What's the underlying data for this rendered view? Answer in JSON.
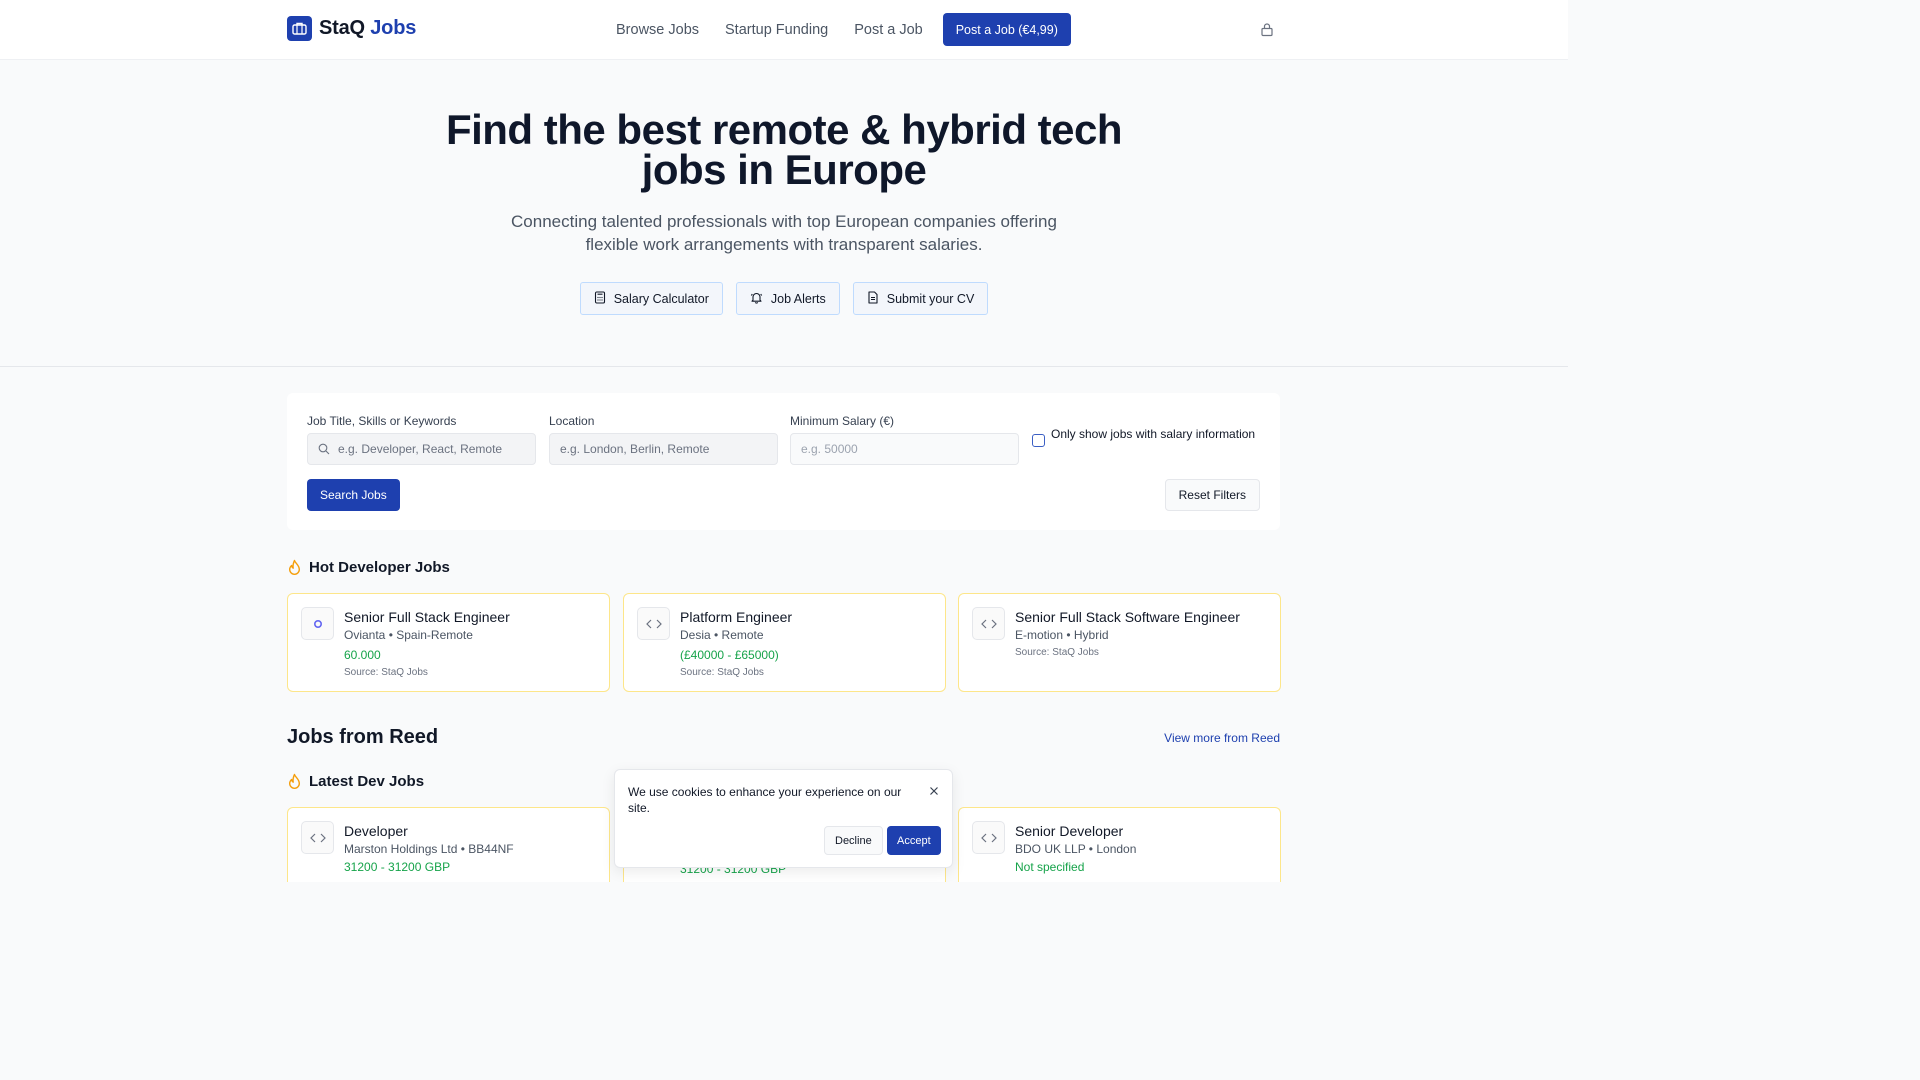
{
  "header": {
    "logo_main": "StaQ",
    "logo_accent": "Jobs",
    "nav": [
      "Browse Jobs",
      "Startup Funding",
      "Post a Job"
    ],
    "cta": "Post a Job (€4,99)"
  },
  "hero": {
    "title": "Find the best remote & hybrid tech jobs in Europe",
    "subtitle": "Connecting talented professionals with top European companies offering flexible work arrangements with transparent salaries.",
    "buttons": [
      "Salary Calculator",
      "Job Alerts",
      "Submit your CV"
    ]
  },
  "search": {
    "keyword_label": "Job Title, Skills or Keywords",
    "keyword_placeholder": "e.g. Developer, React, Remote",
    "location_label": "Location",
    "location_placeholder": "e.g. London, Berlin, Remote",
    "salary_label": "Minimum Salary (€)",
    "salary_placeholder": "e.g. 50000",
    "checkbox_label": "Only show jobs with salary information",
    "search_button": "Search Jobs",
    "reset_button": "Reset Filters"
  },
  "hot": {
    "title": "Hot Developer Jobs",
    "jobs": [
      {
        "title": "Senior Full Stack Engineer",
        "meta": "Ovianta • Spain-Remote",
        "salary": "60.000",
        "source": "Source: StaQ Jobs",
        "icon": "company-logo-icon"
      },
      {
        "title": "Platform Engineer",
        "meta": "Desia • Remote",
        "salary": "(£40000 - £65000)",
        "source": "Source: StaQ Jobs",
        "icon": "code-icon"
      },
      {
        "title": "Senior Full Stack Software Engineer",
        "meta": "E-motion • Hybrid",
        "salary": "",
        "source": "Source: StaQ Jobs",
        "icon": "code-icon"
      }
    ]
  },
  "reed": {
    "title": "Jobs from Reed",
    "link": "View more from Reed",
    "latest_title": "Latest Dev Jobs",
    "jobs": [
      {
        "title": "Developer",
        "meta": "Marston Holdings Ltd • BB44NF",
        "salary": "31200 - 31200 GBP",
        "icon": "code-icon"
      },
      {
        "title": "",
        "meta": "",
        "salary": "31200 - 31200 GBP",
        "icon": "code-icon"
      },
      {
        "title": "Senior Developer",
        "meta": "BDO UK LLP • London",
        "salary": "Not specified",
        "icon": "code-icon"
      }
    ]
  },
  "cookie": {
    "text": "We use cookies to enhance your experience on our site.",
    "decline": "Decline",
    "accept": "Accept"
  },
  "colors": {
    "brand": "#1e40af",
    "salary": "#16a34a",
    "hot": "#f59e0b"
  }
}
